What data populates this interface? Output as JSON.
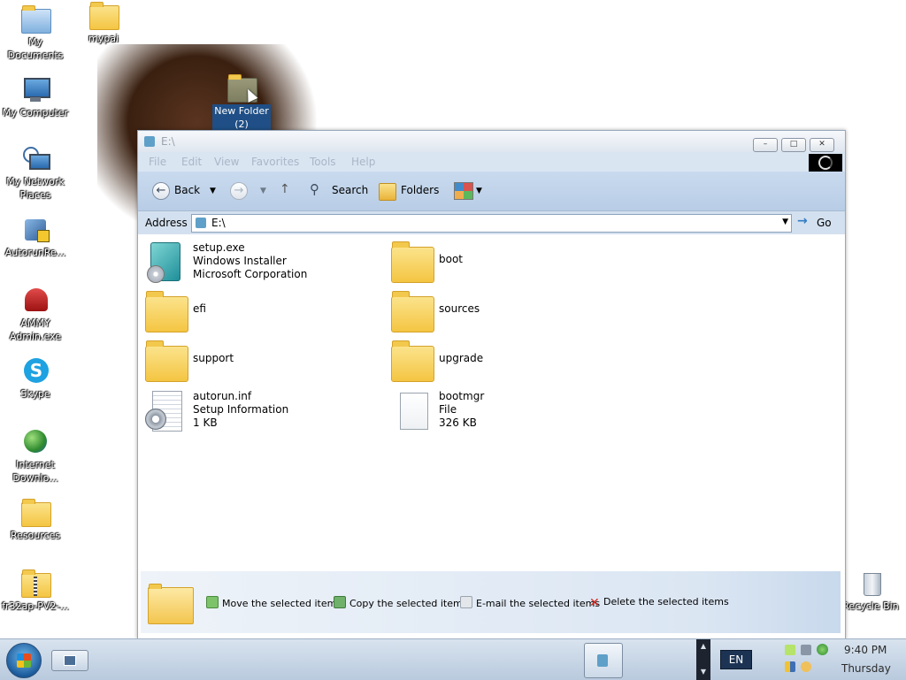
{
  "desktop": {
    "icons": [
      {
        "label": "My\nDocuments"
      },
      {
        "label": "mypai"
      },
      {
        "label": "My Computer"
      },
      {
        "label": "New Folder\n(2)"
      },
      {
        "label": "My Network\nPlaces"
      },
      {
        "label": "AutorunRe..."
      },
      {
        "label": "AMMY\nAdmin.exe"
      },
      {
        "label": "Skype"
      },
      {
        "label": "Internet\nDownlo..."
      },
      {
        "label": "Resources"
      },
      {
        "label": "fr32ap-PV2-..."
      },
      {
        "label": "Recycle Bin"
      }
    ]
  },
  "window": {
    "title": "E:\\",
    "menu": [
      "File",
      "Edit",
      "View",
      "Favorites",
      "Tools",
      "Help"
    ],
    "toolbar": {
      "back": "Back",
      "search": "Search",
      "folders": "Folders"
    },
    "address": {
      "label": "Address",
      "value": "E:\\",
      "go": "Go"
    },
    "items": [
      {
        "name": "setup.exe",
        "line2": "Windows Installer",
        "line3": "Microsoft Corporation",
        "kind": "exe"
      },
      {
        "name": "boot",
        "kind": "folder"
      },
      {
        "name": "efi",
        "kind": "folder"
      },
      {
        "name": "sources",
        "kind": "folder"
      },
      {
        "name": "support",
        "kind": "folder"
      },
      {
        "name": "upgrade",
        "kind": "folder"
      },
      {
        "name": "autorun.inf",
        "line2": "Setup Information",
        "line3": "1 KB",
        "kind": "inf"
      },
      {
        "name": "bootmgr",
        "line2": "File",
        "line3": "326 KB",
        "kind": "file"
      }
    ],
    "tasks": [
      "Move the selected items",
      "Copy the selected items",
      "E-mail the selected items",
      "Delete the selected items"
    ]
  },
  "taskbar": {
    "language": "EN",
    "time": "9:40 PM",
    "day": "Thursday"
  }
}
